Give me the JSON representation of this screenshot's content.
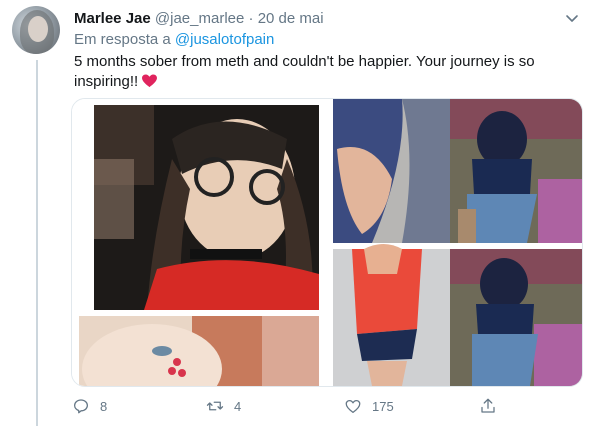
{
  "tweet": {
    "author_name": "Marlee Jae",
    "author_handle": "@jae_marlee",
    "separator": "·",
    "date": "20 de mai",
    "reply_prefix": "Em resposta a",
    "reply_to": "@jusalotofpain",
    "text": "5 months sober from meth and couldn't be happier. Your journey is so inspiring!!",
    "emoji": "red-heart"
  },
  "media": {
    "images": [
      "selfie-red-shirt-glasses",
      "close-up-face-hearts",
      "torso-mirror-photo",
      "mirror-selfie-blue-top-1",
      "red-shirt-mirror-photo",
      "mirror-selfie-blue-top-2"
    ]
  },
  "actions": {
    "reply_count": "8",
    "retweet_count": "4",
    "like_count": "175"
  },
  "colors": {
    "link": "#1b95e0",
    "muted": "#657786",
    "heart": "#e0245e"
  }
}
